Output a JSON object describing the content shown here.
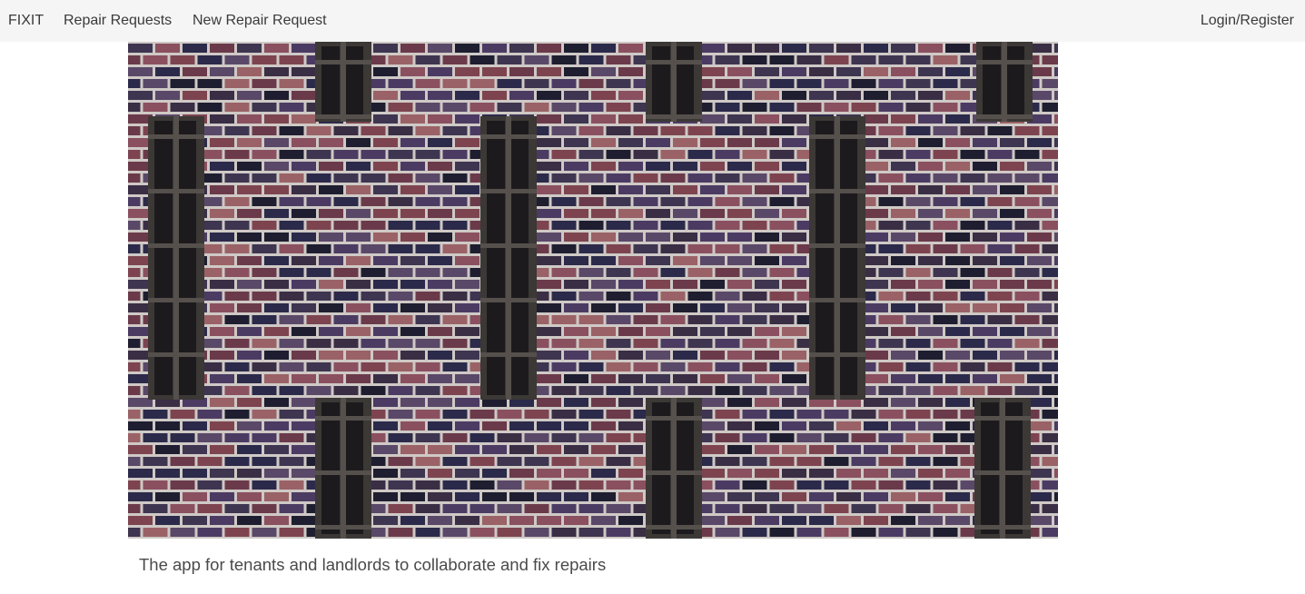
{
  "navbar": {
    "brand": "FIXIT",
    "links": [
      {
        "label": "Repair Requests"
      },
      {
        "label": "New Repair Request"
      }
    ],
    "login_label": "Login/Register"
  },
  "hero": {
    "image_description_icon": "brick-wall-photo",
    "colors": {
      "mortar": "#cfc9c6",
      "brick_palette": [
        "#4b3b63",
        "#2c2a4a",
        "#6b3a4a",
        "#7d4450",
        "#3e3550",
        "#8a5060",
        "#1e1e30",
        "#5a4868",
        "#9a6266",
        "#3a2e45"
      ],
      "window": "#3b3836"
    }
  },
  "main": {
    "tagline": "The app for tenants and landlords to collaborate and fix repairs"
  }
}
